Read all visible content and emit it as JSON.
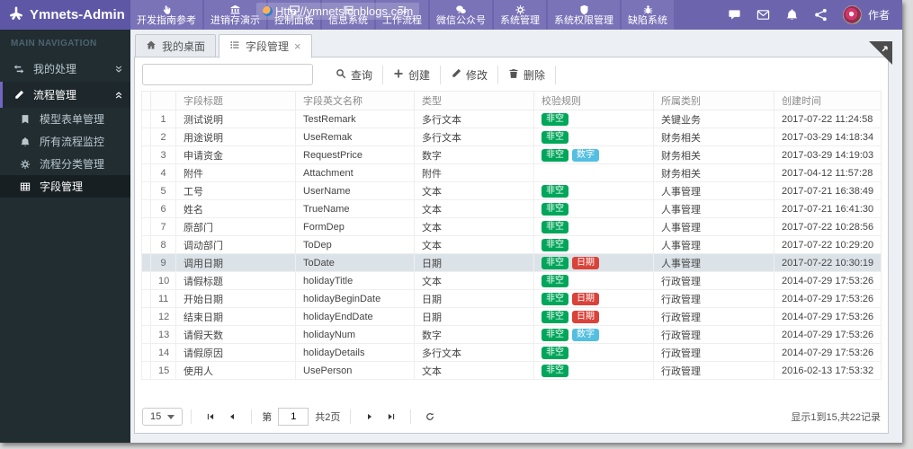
{
  "header": {
    "logo_text": "Ymnets-Admin",
    "watermark": "Http://ymnets.cnblogs.com",
    "nav_items": [
      {
        "label": "开发指南参考",
        "icon": "hand-pointer-icon"
      },
      {
        "label": "进销存演示",
        "icon": "bank-icon"
      },
      {
        "label": "控制面板",
        "icon": "desktop-icon"
      },
      {
        "label": "信息系统",
        "icon": "info-system-icon"
      },
      {
        "label": "工作流程",
        "icon": "workflow-icon"
      },
      {
        "label": "微信公众号",
        "icon": "wechat-icon"
      },
      {
        "label": "系统管理",
        "icon": "gear-icon"
      },
      {
        "label": "系统权限管理",
        "icon": "shield-icon"
      },
      {
        "label": "缺陷系统",
        "icon": "bug-icon"
      }
    ],
    "action_icons": [
      "comment-icon",
      "envelope-icon",
      "bell-icon",
      "share-icon"
    ],
    "user_name": "作者"
  },
  "sidebar": {
    "section_title": "MAIN NAVIGATION",
    "items": [
      {
        "label": "我的处理",
        "icon": "exchange-icon",
        "state": "collapsed",
        "active": false,
        "children": []
      },
      {
        "label": "流程管理",
        "icon": "edit-icon",
        "state": "expanded",
        "active": true,
        "children": [
          {
            "label": "模型表单管理",
            "icon": "book-icon",
            "active": false
          },
          {
            "label": "所有流程监控",
            "icon": "bell-icon",
            "active": false
          },
          {
            "label": "流程分类管理",
            "icon": "gear-icon",
            "active": false
          },
          {
            "label": "字段管理",
            "icon": "table-icon",
            "active": true
          }
        ]
      }
    ]
  },
  "tabs": [
    {
      "label": "我的桌面",
      "icon": "home-icon",
      "active": false,
      "closable": false
    },
    {
      "label": "字段管理",
      "icon": "list-icon",
      "active": true,
      "closable": true,
      "close_glyph": "×"
    }
  ],
  "toolbar": {
    "search_value": "",
    "buttons": [
      {
        "label": "查询",
        "icon": "search-icon"
      },
      {
        "label": "创建",
        "icon": "plus-icon"
      },
      {
        "label": "修改",
        "icon": "pencil-icon"
      },
      {
        "label": "删除",
        "icon": "trash-icon"
      }
    ]
  },
  "table": {
    "columns": [
      "",
      "字段标题",
      "字段英文名称",
      "类型",
      "校验规则",
      "所属类别",
      "创建时间"
    ],
    "badge_colors": {
      "非空": "#00a65a",
      "数字": "#54bfe0",
      "日期": "#d9433a"
    },
    "rows": [
      {
        "num": 1,
        "title": "测试说明",
        "en_name": "TestRemark",
        "type": "多行文本",
        "rules": [
          "非空"
        ],
        "category": "关键业务",
        "created": "2017-07-22 11:24:58",
        "selected": false
      },
      {
        "num": 2,
        "title": "用途说明",
        "en_name": "UseRemak",
        "type": "多行文本",
        "rules": [
          "非空"
        ],
        "category": "财务相关",
        "created": "2017-03-29 14:18:34",
        "selected": false
      },
      {
        "num": 3,
        "title": "申请资金",
        "en_name": "RequestPrice",
        "type": "数字",
        "rules": [
          "非空",
          "数字"
        ],
        "category": "财务相关",
        "created": "2017-03-29 14:19:03",
        "selected": false
      },
      {
        "num": 4,
        "title": "附件",
        "en_name": "Attachment",
        "type": "附件",
        "rules": [],
        "category": "财务相关",
        "created": "2017-04-12 11:57:28",
        "selected": false
      },
      {
        "num": 5,
        "title": "工号",
        "en_name": "UserName",
        "type": "文本",
        "rules": [
          "非空"
        ],
        "category": "人事管理",
        "created": "2017-07-21 16:38:49",
        "selected": false
      },
      {
        "num": 6,
        "title": "姓名",
        "en_name": "TrueName",
        "type": "文本",
        "rules": [
          "非空"
        ],
        "category": "人事管理",
        "created": "2017-07-21 16:41:30",
        "selected": false
      },
      {
        "num": 7,
        "title": "原部门",
        "en_name": "FormDep",
        "type": "文本",
        "rules": [
          "非空"
        ],
        "category": "人事管理",
        "created": "2017-07-22 10:28:56",
        "selected": false
      },
      {
        "num": 8,
        "title": "调动部门",
        "en_name": "ToDep",
        "type": "文本",
        "rules": [
          "非空"
        ],
        "category": "人事管理",
        "created": "2017-07-22 10:29:20",
        "selected": false
      },
      {
        "num": 9,
        "title": "调用日期",
        "en_name": "ToDate",
        "type": "日期",
        "rules": [
          "非空",
          "日期"
        ],
        "category": "人事管理",
        "created": "2017-07-22 10:30:19",
        "selected": true
      },
      {
        "num": 10,
        "title": "请假标题",
        "en_name": "holidayTitle",
        "type": "文本",
        "rules": [
          "非空"
        ],
        "category": "行政管理",
        "created": "2014-07-29 17:53:26",
        "selected": false
      },
      {
        "num": 11,
        "title": "开始日期",
        "en_name": "holidayBeginDate",
        "type": "日期",
        "rules": [
          "非空",
          "日期"
        ],
        "category": "行政管理",
        "created": "2014-07-29 17:53:26",
        "selected": false
      },
      {
        "num": 12,
        "title": "结束日期",
        "en_name": "holidayEndDate",
        "type": "日期",
        "rules": [
          "非空",
          "日期"
        ],
        "category": "行政管理",
        "created": "2014-07-29 17:53:26",
        "selected": false
      },
      {
        "num": 13,
        "title": "请假天数",
        "en_name": "holidayNum",
        "type": "数字",
        "rules": [
          "非空",
          "数字"
        ],
        "category": "行政管理",
        "created": "2014-07-29 17:53:26",
        "selected": false
      },
      {
        "num": 14,
        "title": "请假原因",
        "en_name": "holidayDetails",
        "type": "多行文本",
        "rules": [
          "非空"
        ],
        "category": "行政管理",
        "created": "2014-07-29 17:53:26",
        "selected": false
      },
      {
        "num": 15,
        "title": "使用人",
        "en_name": "UsePerson",
        "type": "文本",
        "rules": [
          "非空"
        ],
        "category": "行政管理",
        "created": "2016-02-13 17:53:32",
        "selected": false
      }
    ]
  },
  "pagination": {
    "page_size": "15",
    "page_label_prefix": "第",
    "page_value": "1",
    "page_label_suffix": "共2页",
    "info": "显示1到15,共22记录"
  }
}
